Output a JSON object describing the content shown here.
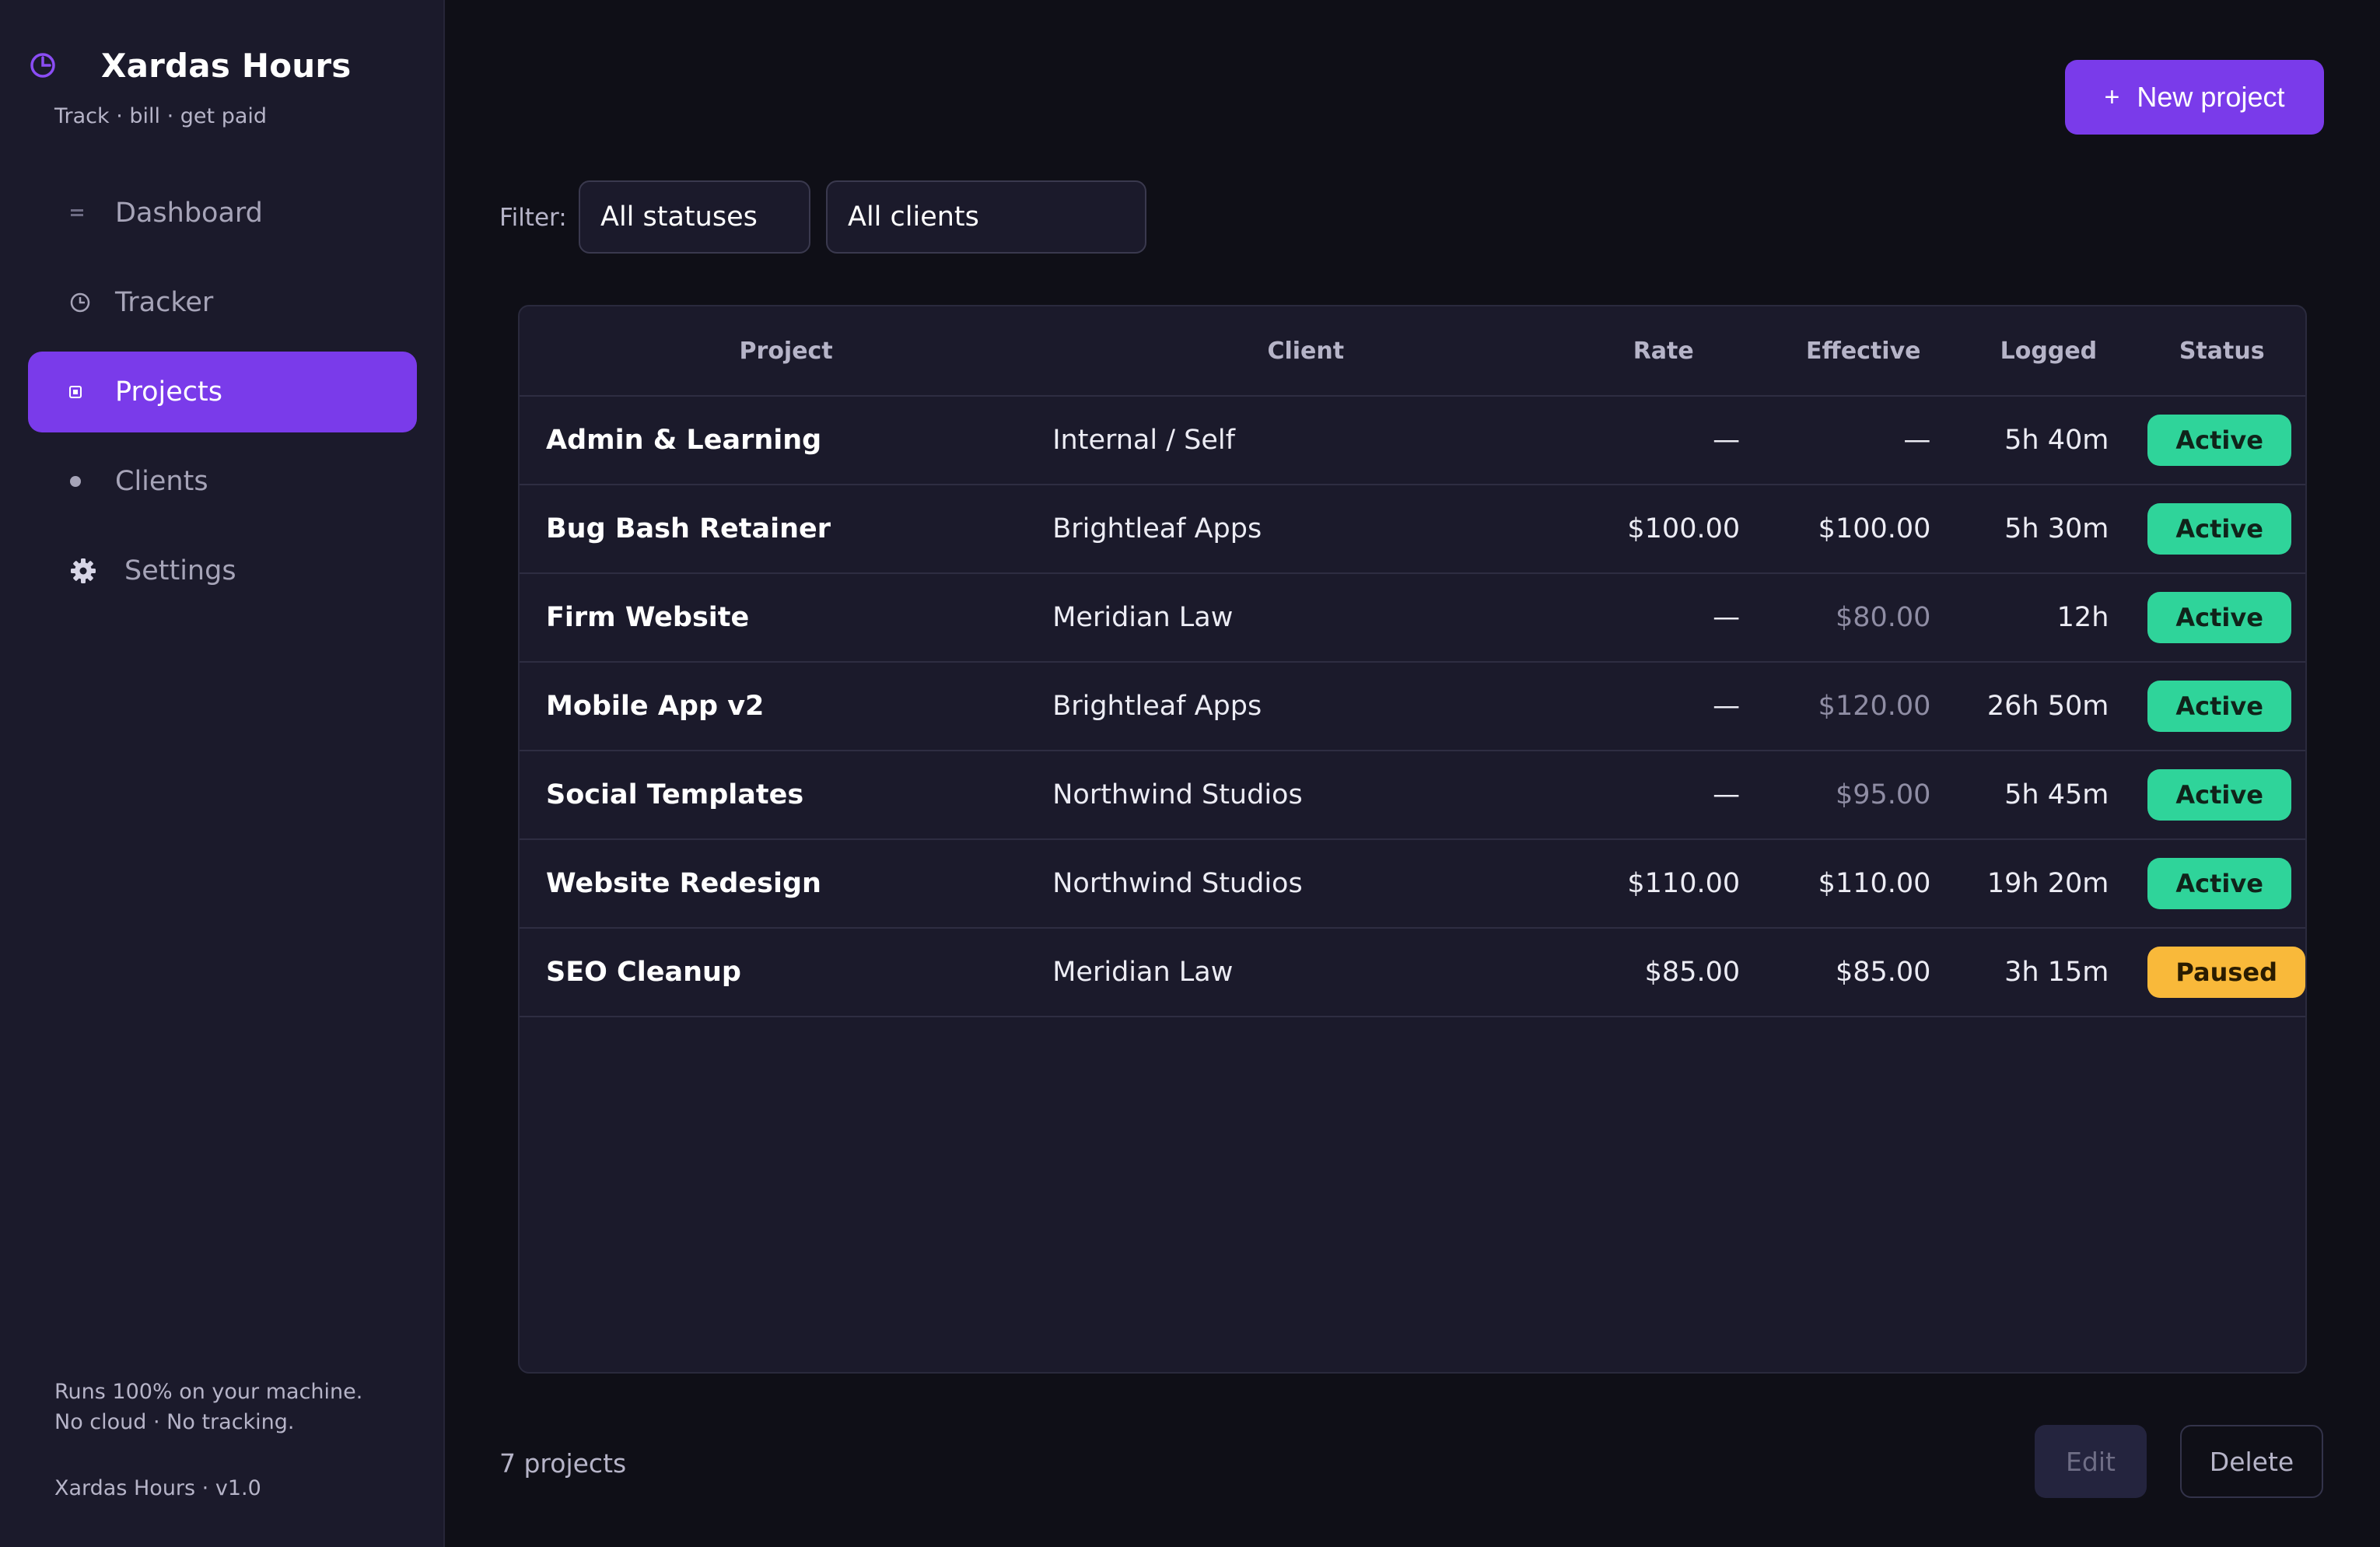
{
  "app": {
    "title": "Xardas Hours",
    "tagline": "Track · bill · get paid",
    "footer_note_line1": "Runs 100% on your machine.",
    "footer_note_line2": "No cloud · No tracking.",
    "version": "Xardas Hours · v1.0"
  },
  "sidebar": {
    "items": [
      {
        "label": "Dashboard",
        "icon": "dashboard-icon"
      },
      {
        "label": "Tracker",
        "icon": "clock-icon"
      },
      {
        "label": "Projects",
        "icon": "folder-icon",
        "active": true
      },
      {
        "label": "Clients",
        "icon": "dot-icon"
      },
      {
        "label": "Settings",
        "icon": "gear-icon"
      }
    ]
  },
  "toolbar": {
    "new_project_label": "New project",
    "new_project_plus": "+",
    "filter_label": "Filter:",
    "status_filter": "All statuses",
    "client_filter": "All clients"
  },
  "table": {
    "headers": {
      "project": "Project",
      "client": "Client",
      "rate": "Rate",
      "effective": "Effective",
      "logged": "Logged",
      "status": "Status"
    },
    "rows": [
      {
        "project": "Admin & Learning",
        "client": "Internal / Self",
        "rate": "—",
        "effective": "—",
        "logged": "5h 40m",
        "status": "Active"
      },
      {
        "project": "Bug Bash Retainer",
        "client": "Brightleaf Apps",
        "rate": "$100.00",
        "effective": "$100.00",
        "logged": "5h 30m",
        "status": "Active"
      },
      {
        "project": "Firm Website",
        "client": "Meridian Law",
        "rate": "—",
        "effective": "$80.00",
        "logged": "12h",
        "status": "Active"
      },
      {
        "project": "Mobile App v2",
        "client": "Brightleaf Apps",
        "rate": "—",
        "effective": "$120.00",
        "logged": "26h 50m",
        "status": "Active"
      },
      {
        "project": "Social Templates",
        "client": "Northwind Studios",
        "rate": "—",
        "effective": "$95.00",
        "logged": "5h 45m",
        "status": "Active"
      },
      {
        "project": "Website Redesign",
        "client": "Northwind Studios",
        "rate": "$110.00",
        "effective": "$110.00",
        "logged": "19h 20m",
        "status": "Active"
      },
      {
        "project": "SEO Cleanup",
        "client": "Meridian Law",
        "rate": "$85.00",
        "effective": "$85.00",
        "logged": "3h 15m",
        "status": "Paused"
      }
    ]
  },
  "footer": {
    "count_label": "7 projects",
    "edit_label": "Edit",
    "delete_label": "Delete"
  },
  "colors": {
    "accent": "#7a3bea",
    "active_badge": "#2fd49a",
    "paused_badge": "#f9b93a",
    "background": "#0f0f17",
    "panel": "#1b1a2b"
  }
}
